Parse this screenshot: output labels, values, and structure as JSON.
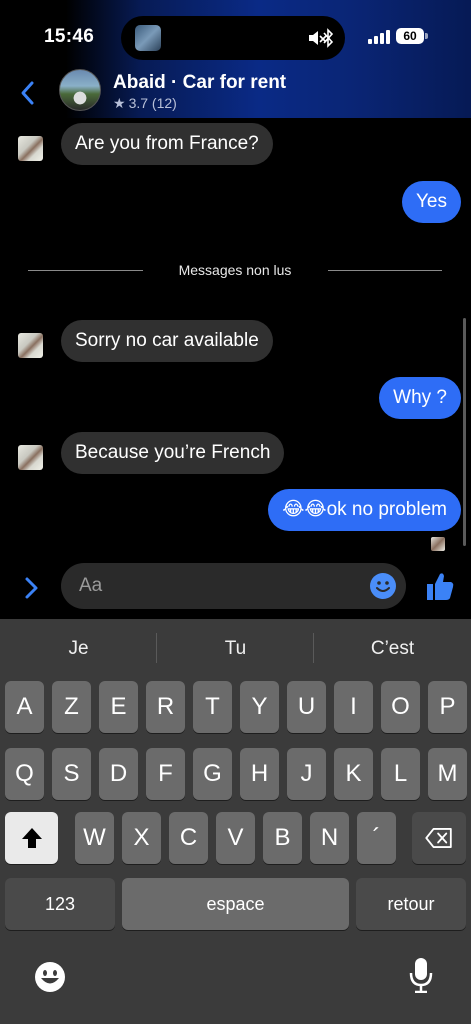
{
  "status": {
    "time": "15:46",
    "battery": "60"
  },
  "header": {
    "name": "Abaid · Car for rent",
    "rating": "3.7 (12)"
  },
  "messages": [
    {
      "dir": "in",
      "text": "Are you from France?"
    },
    {
      "dir": "out",
      "text": "Yes"
    },
    {
      "dir": "in",
      "text": "Sorry no car available"
    },
    {
      "dir": "out",
      "text": "Why ?"
    },
    {
      "dir": "in",
      "text": "Because you’re French"
    },
    {
      "dir": "out",
      "text": "😂😂ok no problem"
    }
  ],
  "divider_label": "Messages non lus",
  "composer": {
    "placeholder": "Aa"
  },
  "keyboard": {
    "suggestions": [
      "Je",
      "Tu",
      "C’est"
    ],
    "row1": [
      "A",
      "Z",
      "E",
      "R",
      "T",
      "Y",
      "U",
      "I",
      "O",
      "P"
    ],
    "row2": [
      "Q",
      "S",
      "D",
      "F",
      "G",
      "H",
      "J",
      "K",
      "L",
      "M"
    ],
    "row3": [
      "W",
      "X",
      "C",
      "V",
      "B",
      "N",
      "´"
    ],
    "numbers_label": "123",
    "space_label": "espace",
    "return_label": "retour"
  },
  "colors": {
    "accent": "#2e6df6",
    "incoming_bubble": "#303030",
    "keyboard_bg": "#3b3b3b",
    "key_bg": "#6b6b6b"
  }
}
